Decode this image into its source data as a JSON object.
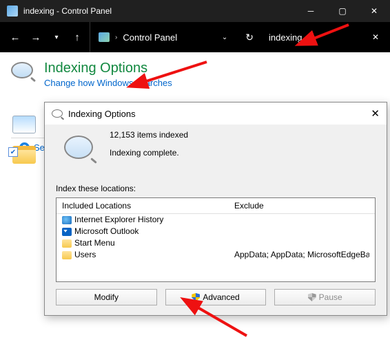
{
  "titlebar": {
    "title": "indexing - Control Panel"
  },
  "nav": {
    "address_label": "Control Panel",
    "search_value": "indexing"
  },
  "cp": {
    "title": "Indexing Options",
    "subtitle": "Change how Windows searches",
    "see_all": "Search Windows Help and Support for \"indexing\""
  },
  "dialog": {
    "title": "Indexing Options",
    "items_indexed": "12,153 items indexed",
    "status": "Indexing complete.",
    "locations_label": "Index these locations:",
    "col_included": "Included Locations",
    "col_exclude": "Exclude",
    "rows": [
      {
        "icon": "ie",
        "name": "Internet Explorer History",
        "exclude": ""
      },
      {
        "icon": "ol",
        "name": "Microsoft Outlook",
        "exclude": ""
      },
      {
        "icon": "folder",
        "name": "Start Menu",
        "exclude": ""
      },
      {
        "icon": "folder",
        "name": "Users",
        "exclude": "AppData; AppData; MicrosoftEdgeBackups"
      }
    ],
    "buttons": {
      "modify": "Modify",
      "advanced": "Advanced",
      "pause": "Pause"
    }
  }
}
